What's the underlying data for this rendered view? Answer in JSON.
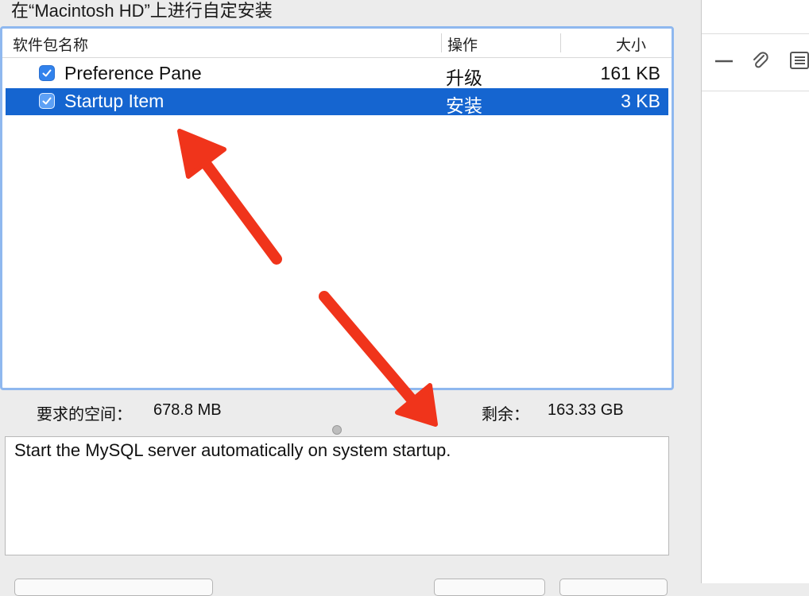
{
  "window": {
    "title": "在“Macintosh HD”上进行自定安装"
  },
  "table": {
    "columns": {
      "name": "软件包名称",
      "action": "操作",
      "size": "大小"
    },
    "rows": [
      {
        "name": "Preference Pane",
        "action": "升级",
        "size": "161 KB",
        "checked": true,
        "selected": false
      },
      {
        "name": "Startup Item",
        "action": "安装",
        "size": "3 KB",
        "checked": true,
        "selected": true
      }
    ]
  },
  "space": {
    "required_label": "要求的空间：",
    "required_value": "678.8 MB",
    "remaining_label": "剩余：",
    "remaining_value": "163.33 GB"
  },
  "description": {
    "text": "Start the MySQL server automatically on system startup."
  },
  "colors": {
    "selection": "#1565d0",
    "focus_ring": "#8fb8ef",
    "checkbox": "#3182ec",
    "annotation_arrow": "#f0341b"
  },
  "right_panel": {
    "icons": [
      "minus-icon",
      "paperclip-icon",
      "list-icon"
    ]
  }
}
